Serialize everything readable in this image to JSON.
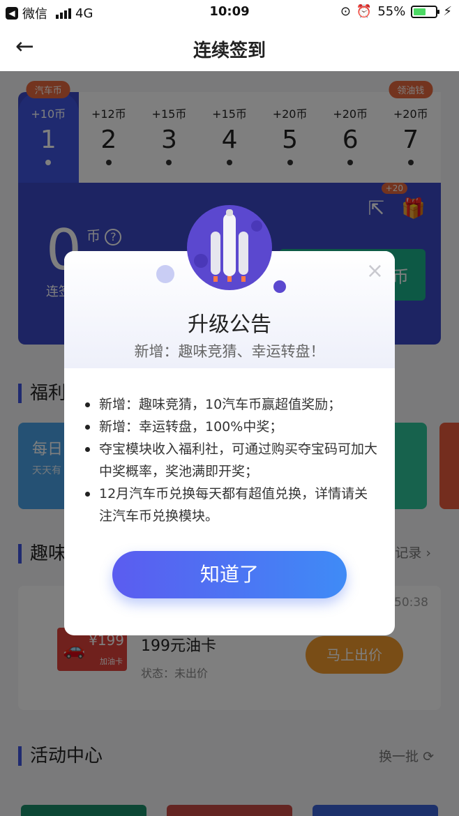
{
  "status_bar": {
    "carrier": "微信",
    "network": "4G",
    "time": "10:09",
    "battery": "55%",
    "battery_level": 0.55
  },
  "nav": {
    "back_icon": "←",
    "title": "连续签到"
  },
  "checkin": {
    "days": [
      {
        "tag": "汽车币",
        "coins": "+10币",
        "day": "1"
      },
      {
        "tag": "",
        "coins": "+12币",
        "day": "2"
      },
      {
        "tag": "",
        "coins": "+15币",
        "day": "3"
      },
      {
        "tag": "",
        "coins": "+15币",
        "day": "4"
      },
      {
        "tag": "",
        "coins": "+20币",
        "day": "5"
      },
      {
        "tag": "",
        "coins": "+20币",
        "day": "6"
      },
      {
        "tag": "领油钱",
        "coins": "+20币",
        "day": "7"
      }
    ],
    "balance": "0",
    "balance_unit": "币",
    "help_icon": "?",
    "streak_label": "连签",
    "gift_badge": "+20",
    "button_text": "币"
  },
  "sections": {
    "welfare": "福利",
    "welfare_card_title": "每日",
    "welfare_card_sub": "天天有",
    "fun": "趣味",
    "fun_record": "记录 ›",
    "timer": "50:38",
    "fuel_card_price": "¥199",
    "fuel_card_label": "加油卡",
    "fuel_card_name": "199元油卡",
    "fuel_status": "状态：未出价",
    "bid_button": "马上出价",
    "activity": "活动中心",
    "swap": "换一批 ⟳"
  },
  "modal": {
    "close_icon": "×",
    "title": "升级公告",
    "subtitle": "新增：趣味竞猜、幸运转盘！",
    "items": [
      "新增：趣味竞猜，10汽车币赢超值奖励；",
      "新增：幸运转盘，100%中奖；",
      "夺宝模块收入福利社，可通过购买夺宝码可加大中奖概率，奖池满即开奖；",
      "12月汽车币兑换每天都有超值兑换，详情请关注汽车币兑换模块。"
    ],
    "confirm_button": "知道了"
  },
  "colors": {
    "primary": "#3f55e0",
    "accent_orange": "#e7693e",
    "green": "#1ab38a",
    "button_gradient_start": "#5b5cf0",
    "button_gradient_end": "#3f8bf6"
  }
}
